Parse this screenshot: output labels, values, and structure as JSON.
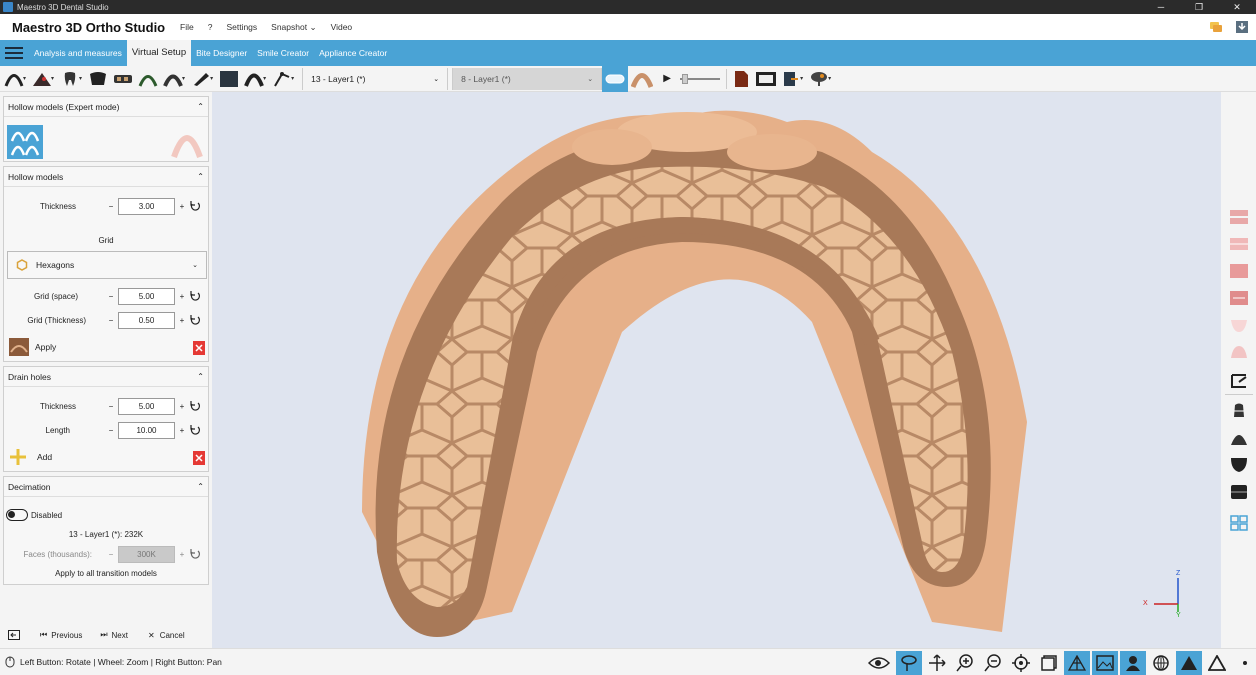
{
  "window": {
    "title": "Maestro 3D Dental Studio",
    "controls": [
      "─",
      "❐",
      "✕"
    ]
  },
  "menubar": {
    "brand": "Maestro 3D Ortho Studio",
    "items": [
      "File",
      "?",
      "Settings",
      "Snapshot",
      "Video"
    ],
    "snapshot_caret": "⌄"
  },
  "tabs": [
    {
      "label": "Analysis and measures",
      "active": false
    },
    {
      "label": "Virtual Setup",
      "active": true
    },
    {
      "label": "Bite Designer",
      "active": false
    },
    {
      "label": "Smile Creator",
      "active": false
    },
    {
      "label": "Appliance Creator",
      "active": false
    }
  ],
  "toolbar": {
    "layer_select": "13 - Layer1 (*)",
    "compare_select": "8 - Layer1 (*)",
    "play_icon": "▶"
  },
  "panel": {
    "hollow_expert": {
      "title": "Hollow models (Expert mode)"
    },
    "hollow": {
      "title": "Hollow models",
      "thickness_label": "Thickness",
      "thickness_value": "3.00",
      "grid_heading": "Grid",
      "grid_type": "Hexagons",
      "grid_space_label": "Grid (space)",
      "grid_space_value": "5.00",
      "grid_thickness_label": "Grid (Thickness)",
      "grid_thickness_value": "0.50",
      "apply_label": "Apply"
    },
    "drain": {
      "title": "Drain holes",
      "thickness_label": "Thickness",
      "thickness_value": "5.00",
      "length_label": "Length",
      "length_value": "10.00",
      "add_label": "Add"
    },
    "decimation": {
      "title": "Decimation",
      "toggle_label": "Disabled",
      "info": "13 - Layer1 (*): 232K",
      "faces_label": "Faces (thousands):",
      "faces_value": "300K",
      "apply_all_label": "Apply to all transition models"
    },
    "nav": {
      "previous": "Previous",
      "next": "Next",
      "cancel": "Cancel"
    }
  },
  "axes": {
    "x": "X",
    "y": "Y",
    "z": "Z"
  },
  "status": {
    "hint": "Left Button: Rotate | Wheel: Zoom | Right Button: Pan"
  },
  "colors": {
    "accent": "#4aa3d5",
    "titlebar": "#2b2b2b",
    "viewport": "#dfe4ef",
    "model": "#e8b48c",
    "shell": "#a87958"
  }
}
